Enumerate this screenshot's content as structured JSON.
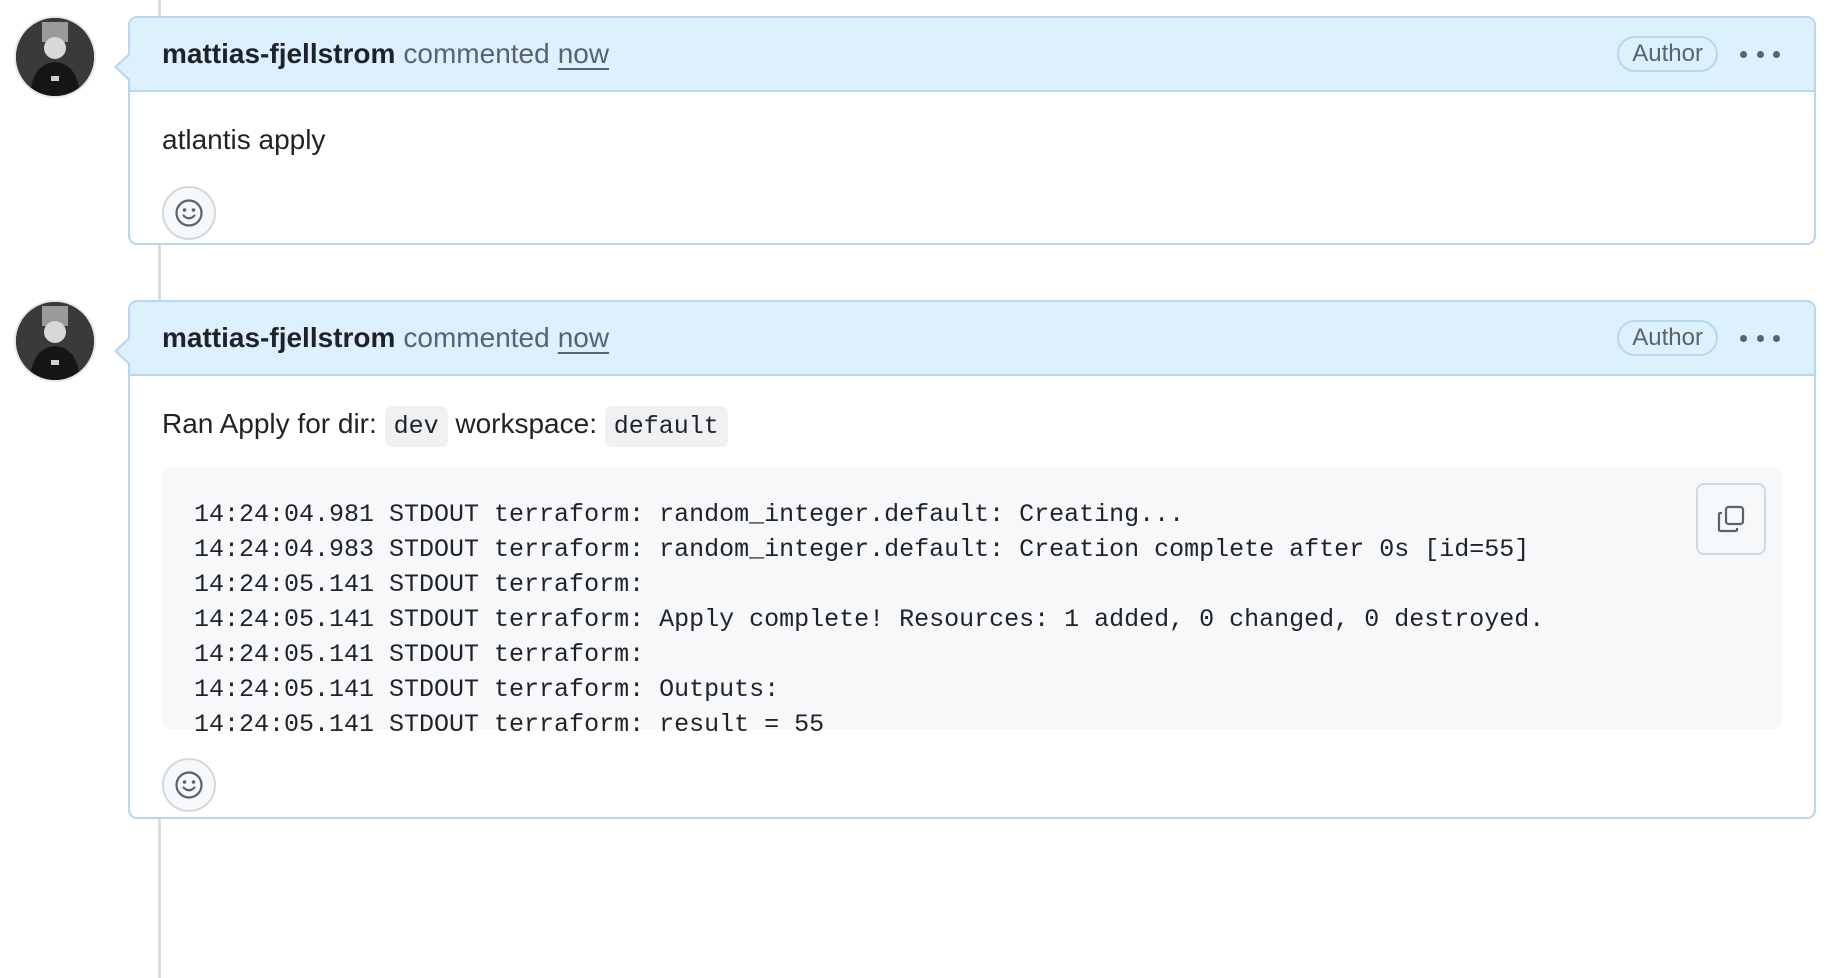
{
  "comments": [
    {
      "author": "mattias-fjellstrom",
      "action": "commented",
      "time": "now",
      "badge": "Author",
      "body": "atlantis apply"
    },
    {
      "author": "mattias-fjellstrom",
      "action": "commented",
      "time": "now",
      "badge": "Author",
      "body_prefix": "Ran Apply for dir:",
      "dir": "dev",
      "workspace_label": "workspace:",
      "workspace": "default",
      "code_lines": [
        "14:24:04.981 STDOUT terraform: random_integer.default: Creating...",
        "14:24:04.983 STDOUT terraform: random_integer.default: Creation complete after 0s [id=55]",
        "14:24:05.141 STDOUT terraform:",
        "14:24:05.141 STDOUT terraform: Apply complete! Resources: 1 added, 0 changed, 0 destroyed.",
        "14:24:05.141 STDOUT terraform:",
        "14:24:05.141 STDOUT terraform: Outputs:",
        "14:24:05.141 STDOUT terraform: result = 55"
      ]
    }
  ],
  "icons": {
    "more": "kebab-horizontal-icon",
    "copy": "copy-icon",
    "reaction": "smiley-icon"
  },
  "colors": {
    "header_bg": "#ddf0fd",
    "border": "#b6d6f2",
    "code_bg": "#f6f8fa"
  }
}
